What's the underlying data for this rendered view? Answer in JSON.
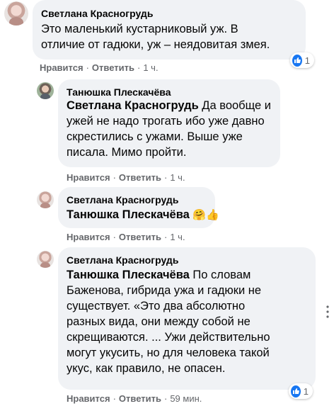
{
  "comments": [
    {
      "author": "Светлана Красногрудь",
      "lines": [
        "Это маленький кустарниковый уж. В",
        "отличие от гадюки, уж – неядовитая змея."
      ],
      "like": "Нравится",
      "reply": "Ответить",
      "time": "1 ч.",
      "reactions": "1"
    },
    {
      "author": "Танюшка Плескачёва",
      "mention": "Светлана Красногрудь",
      "lines": [
        " Да вообще и",
        "ужей не надо трогать ибо уже давно",
        "скрестились с ужами. Выше уже",
        "писала. Мимо пройти."
      ],
      "like": "Нравится",
      "reply": "Ответить",
      "time": "1 ч."
    },
    {
      "author": "Светлана Красногрудь",
      "mention": "Танюшка Плескачёва",
      "emoji": "🤗👍",
      "like": "Нравится",
      "reply": "Ответить",
      "time": "1 ч."
    },
    {
      "author": "Светлана Красногрудь",
      "mention": "Танюшка Плескачёва",
      "lines": [
        " По словам",
        "Баженова, гибрида ужа и гадюки не",
        "существует. «Это два абсолютно",
        "разных вида, они между собой не",
        "скрещиваются. ... Ужи действительно",
        "могут укусить, но для человека такой",
        "укус, как правило, не опасен."
      ],
      "like": "Нравится",
      "reply": "Ответить",
      "time": "59 мин.",
      "reactions": "1"
    }
  ],
  "colors": {
    "bubble": "#f0f2f5",
    "secondary_text": "#65676b",
    "like_blue": "#1877f2"
  },
  "icons": [
    "like-icon",
    "three-dots-icon"
  ]
}
